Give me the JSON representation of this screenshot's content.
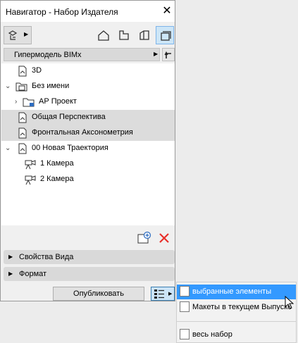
{
  "window": {
    "title": "Навигатор - Набор Издателя"
  },
  "toolbar": {
    "buttons": [
      "publisher-set-icon",
      "project-map-icon",
      "view-map-icon",
      "layout-book-icon",
      "publisher-sets-icon"
    ]
  },
  "model": {
    "label": "Гипермодель BIMx"
  },
  "tree": {
    "items": [
      {
        "label": "3D",
        "indent": 1,
        "chevron": "",
        "highlight": false
      },
      {
        "label": "Без имени",
        "indent": 0,
        "chevron": "expanded",
        "highlight": false
      },
      {
        "label": "АР Проект",
        "indent": 1,
        "chevron": "collapsed",
        "highlight": false
      },
      {
        "label": "Общая Перспектива",
        "indent": 1,
        "chevron": "",
        "highlight": true
      },
      {
        "label": "Фронтальная Аксонометрия",
        "indent": 1,
        "chevron": "",
        "highlight": true
      },
      {
        "label": "00 Новая Траектория",
        "indent": 0,
        "chevron": "expanded",
        "highlight": false
      },
      {
        "label": "1 Камера",
        "indent": 2,
        "chevron": "",
        "highlight": false
      },
      {
        "label": "2 Камера",
        "indent": 2,
        "chevron": "",
        "highlight": false
      }
    ]
  },
  "panels": {
    "view_props": "Свойства Вида",
    "format": "Формат"
  },
  "footer": {
    "publish_label": "Опубликовать"
  },
  "dropdown": {
    "items": [
      {
        "label": "выбранные элементы",
        "selected": true
      },
      {
        "label": "Макеты в текущем Выпуске",
        "selected": false
      },
      {
        "label": "весь набор",
        "selected": false
      }
    ]
  },
  "colors": {
    "accent": "#3399ff",
    "delete": "#e8302a",
    "highlight_row": "#dcdcdc"
  }
}
